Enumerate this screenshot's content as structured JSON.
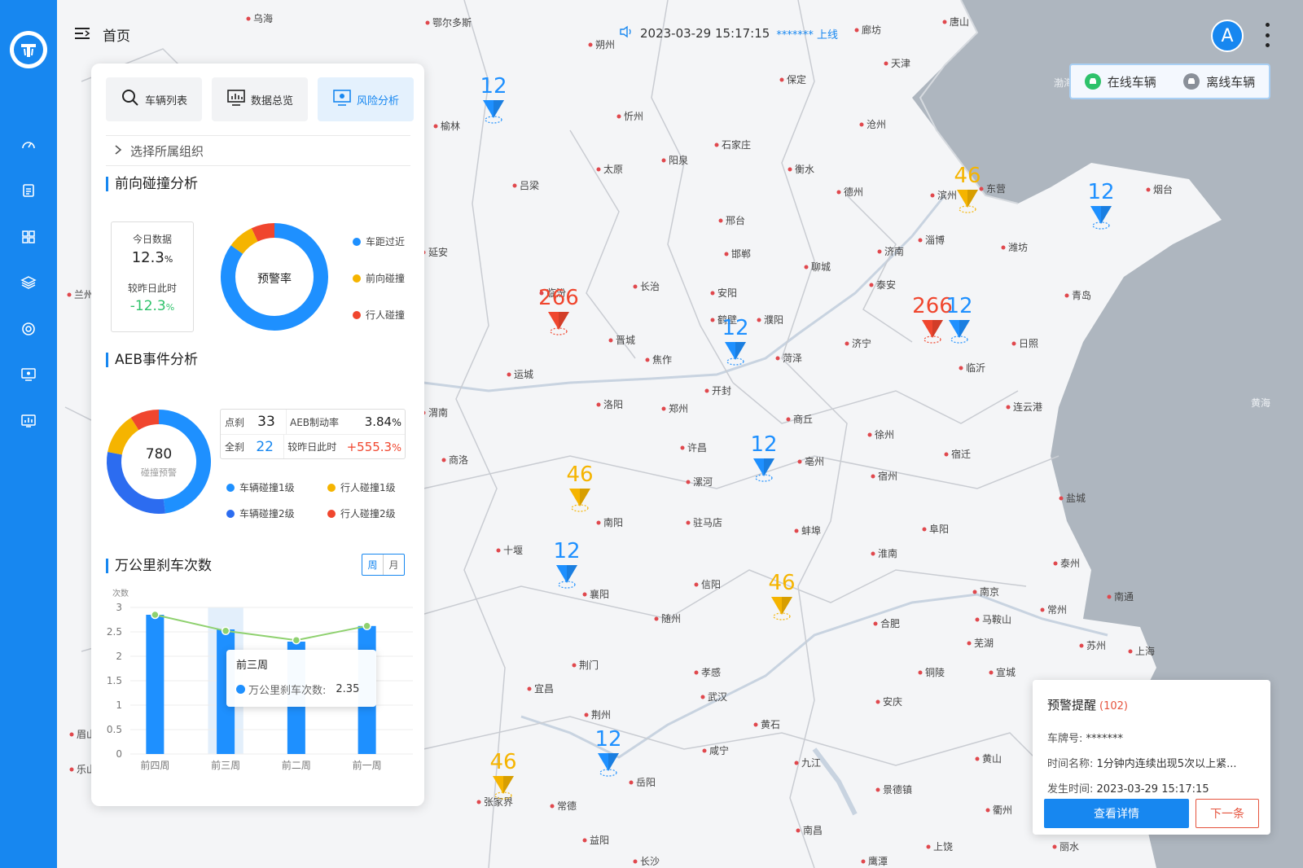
{
  "header": {
    "menu_title": "首页",
    "timestamp": "2023-03-29 15:17:15",
    "user": "******* 上线",
    "avatar_letter": "A"
  },
  "map_legend": {
    "online": "在线车辆",
    "offline": "离线车辆"
  },
  "tabs": [
    {
      "label": "车辆列表"
    },
    {
      "label": "数据总览"
    },
    {
      "label": "风险分析"
    }
  ],
  "org_select": "选择所属组织",
  "forward": {
    "title": "前向碰撞分析",
    "today_label": "今日数据",
    "today_value": "12.3",
    "percent": "%",
    "compare_label": "较昨日此时",
    "compare_value": "-12.3",
    "donut_center": "预警率",
    "legend": [
      "车距过近",
      "前向碰撞",
      "行人碰撞"
    ],
    "slices": [
      {
        "name": "车距过近",
        "value": 85,
        "color": "#1e90ff"
      },
      {
        "name": "前向碰撞",
        "value": 8,
        "color": "#f5b400"
      },
      {
        "name": "行人碰撞",
        "value": 7,
        "color": "#f0462e"
      }
    ]
  },
  "aeb": {
    "title": "AEB事件分析",
    "total": "780",
    "total_label": "碰撞预警",
    "point_label": "点刹",
    "point_value": "33",
    "full_label": "全刹",
    "full_value": "22",
    "rate_label": "AEB制动率",
    "rate_value": "3.84",
    "compare_label": "较昨日此时",
    "compare_value": "+555.3",
    "percent": "%",
    "legend": [
      "车辆碰撞1级",
      "行人碰撞1级",
      "车辆碰撞2级",
      "行人碰撞2级"
    ],
    "slices": [
      {
        "name": "车辆碰撞1级",
        "value": 48,
        "color": "#1e90ff"
      },
      {
        "name": "车辆碰撞2级",
        "value": 30,
        "color": "#2c6cf0"
      },
      {
        "name": "行人碰撞1级",
        "value": 13,
        "color": "#f5b400"
      },
      {
        "name": "行人碰撞2级",
        "value": 9,
        "color": "#f0462e"
      }
    ]
  },
  "braking": {
    "title": "万公里刹车次数",
    "toggle_week": "周",
    "toggle_month": "月",
    "tooltip_title": "前三周",
    "tooltip_series": "万公里刹车次数:",
    "tooltip_value": "2.35"
  },
  "chart_data": {
    "type": "bar",
    "ylabel": "次数",
    "categories": [
      "前四周",
      "前三周",
      "前二周",
      "前一周"
    ],
    "values": [
      2.85,
      2.55,
      2.3,
      2.62
    ],
    "line_values": [
      2.85,
      2.52,
      2.33,
      2.62
    ],
    "ylim": [
      0,
      3
    ],
    "yticks": [
      "0",
      "0.5",
      "1",
      "1.5",
      "2",
      "2.5",
      "3"
    ],
    "bar_color": "#1e90ff",
    "line_color": "#8fd16f"
  },
  "markers": [
    {
      "value": "12",
      "color": "#1e90ff"
    },
    {
      "value": "46",
      "color": "#f5b400"
    },
    {
      "value": "12",
      "color": "#1e90ff"
    },
    {
      "value": "266",
      "color": "#f0462e"
    },
    {
      "value": "12",
      "color": "#1e90ff"
    },
    {
      "value": "266",
      "color": "#f0462e"
    },
    {
      "value": "12",
      "color": "#1e90ff"
    },
    {
      "value": "12",
      "color": "#1e90ff"
    },
    {
      "value": "46",
      "color": "#f5b400"
    },
    {
      "value": "12",
      "color": "#1e90ff"
    },
    {
      "value": "46",
      "color": "#f5b400"
    },
    {
      "value": "12",
      "color": "#1e90ff"
    },
    {
      "value": "46",
      "color": "#f5b400"
    }
  ],
  "cities": [
    "乌海",
    "鄂尔多斯",
    "朔州",
    "唐山",
    "天津",
    "保定",
    "廊坊",
    "榆林",
    "忻州",
    "沧州",
    "石家庄",
    "阳泉",
    "太原",
    "吕梁",
    "衡水",
    "德州",
    "滨州",
    "东营",
    "烟台",
    "邢台",
    "淄博",
    "潍坊",
    "济南",
    "邯郸",
    "聊城",
    "延安",
    "长治",
    "泰安",
    "青岛",
    "临汾",
    "安阳",
    "鹤壁",
    "濮阳",
    "日照",
    "晋城",
    "济宁",
    "临沂",
    "焦作",
    "菏泽",
    "运城",
    "开封",
    "洛阳",
    "郑州",
    "商丘",
    "连云港",
    "徐州",
    "渭南",
    "宿迁",
    "许昌",
    "亳州",
    "商洛",
    "漯河",
    "宿州",
    "盐城",
    "南阳",
    "驻马店",
    "蚌埠",
    "阜阳",
    "十堰",
    "淮南",
    "泰州",
    "信阳",
    "襄阳",
    "南京",
    "南通",
    "随州",
    "马鞍山",
    "常州",
    "合肥",
    "芜湖",
    "苏州",
    "上海",
    "荆门",
    "铜陵",
    "宣城",
    "宜昌",
    "孝感",
    "武汉",
    "安庆",
    "荆州",
    "黄石",
    "咸宁",
    "九江",
    "黄山",
    "岳阳",
    "景德镇",
    "常德",
    "衢州",
    "南昌",
    "益阳",
    "上饶",
    "丽水",
    "长沙",
    "鹰潭",
    "兰州",
    "眉山",
    "乐山",
    "张家界",
    "黄海",
    "渤海"
  ],
  "alert": {
    "title": "预警提醒",
    "count": "(102)",
    "plate_label": "车牌号:",
    "plate_value": "*******",
    "event_label": "时间名称:",
    "event_value": "1分钟内连续出现5次以上紧...",
    "time_label": "发生时间:",
    "time_value": "2023-03-29 15:17:15",
    "detail_button": "查看详情",
    "next_button": "下一条"
  }
}
